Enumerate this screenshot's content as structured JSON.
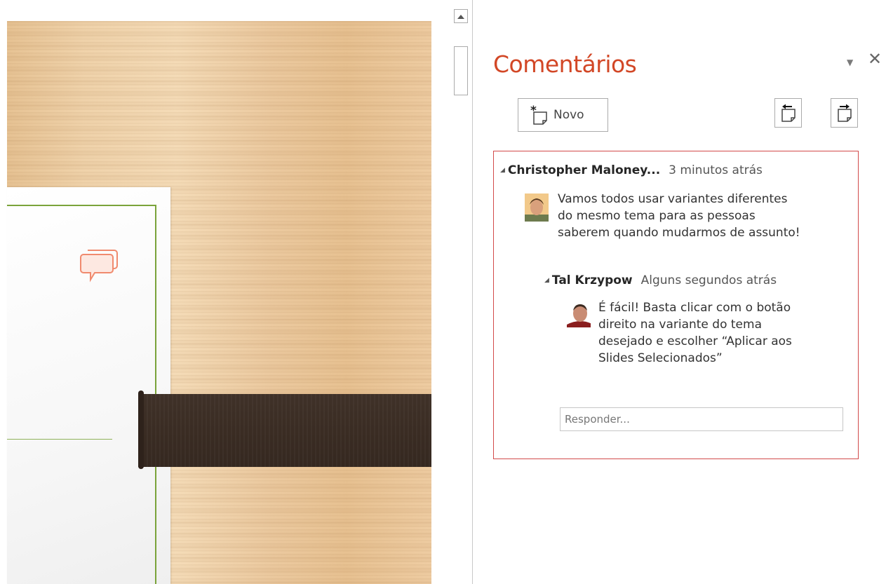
{
  "pane": {
    "title": "Comentários",
    "new_button_label": "Novo",
    "new_icon": "new-comment-icon",
    "previous_icon": "previous-comment-icon",
    "next_icon": "next-comment-icon",
    "dropdown_glyph": "▼",
    "close_glyph": "✕"
  },
  "thread": {
    "comment": {
      "author": "Christopher Maloney...",
      "time": "3 minutos atrás",
      "text": "Vamos todos usar variantes diferentes\ndo mesmo tema para as pessoas\nsaberem quando mudarmos de assunto!"
    },
    "reply": {
      "author": "Tal Krzypow",
      "time": "Alguns segundos atrás",
      "text": "É fácil! Basta clicar com o botão\ndireito na variante do tema\ndesejado e escolher “Aplicar aos\nSlides Selecionados”"
    },
    "reply_placeholder": "Responder..."
  },
  "colors": {
    "accent": "#d24726",
    "thread_border": "#d24a4a",
    "slide_frame": "#7aa33a",
    "dark_bar": "#3a2c23"
  }
}
